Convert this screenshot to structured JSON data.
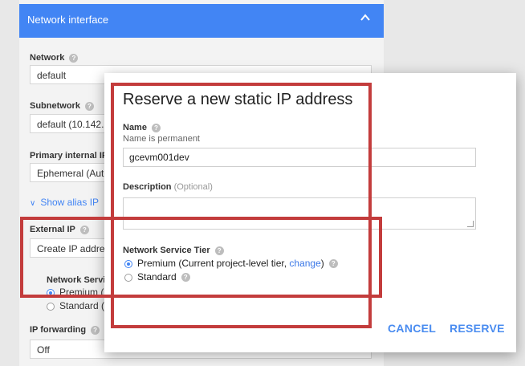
{
  "background": {
    "header_title": "Network interface",
    "network": {
      "label": "Network",
      "value": "default"
    },
    "subnetwork": {
      "label": "Subnetwork",
      "value": "default (10.142."
    },
    "primary_ip": {
      "label": "Primary internal IP",
      "value": "Ephemeral (Auto"
    },
    "alias_link": "Show alias IP",
    "external_ip": {
      "label": "External IP",
      "value": "Create IP addres"
    },
    "tier_label": "Network Servic",
    "tier_premium": "Premium (",
    "tier_standard": "Standard (",
    "ip_forwarding": {
      "label": "IP forwarding",
      "value": "Off"
    }
  },
  "dialog": {
    "title": "Reserve a new static IP address",
    "name_label": "Name",
    "name_hint": "Name is permanent",
    "name_value": "gcevm001dev",
    "description_label": "Description",
    "description_optional": "(Optional)",
    "tier_label": "Network Service Tier",
    "premium_text": "Premium (Current project-level tier, ",
    "premium_link": "change",
    "premium_close": ")",
    "standard_text": "Standard",
    "cancel_label": "CANCEL",
    "reserve_label": "RESERVE"
  },
  "colors": {
    "accent": "#4285f4",
    "highlight": "#c33c3c"
  }
}
